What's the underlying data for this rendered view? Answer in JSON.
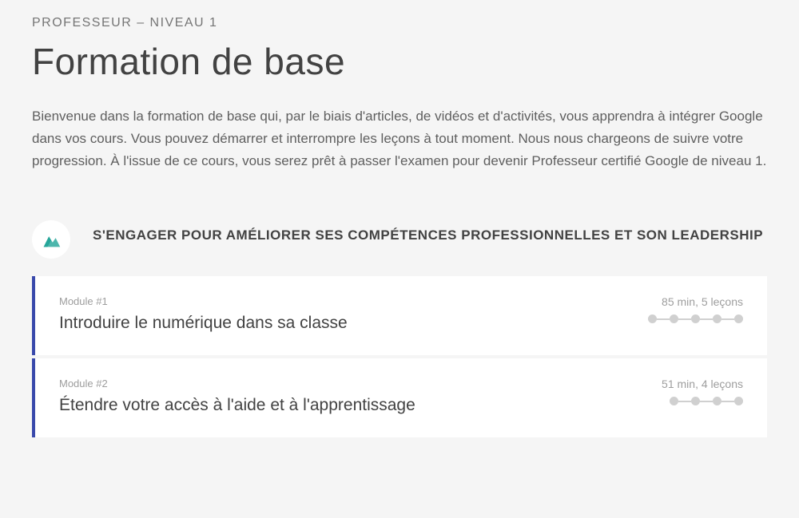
{
  "eyebrow": "PROFESSEUR – NIVEAU 1",
  "title": "Formation de base",
  "intro": "Bienvenue dans la formation de base qui, par le biais d'articles, de vidéos et d'activités, vous apprendra à intégrer Google dans vos cours. Vous pouvez démarrer et interrompre les leçons à tout moment. Nous nous chargeons de suivre votre progression. À l'issue de ce cours, vous serez prêt à passer l'examen pour devenir Professeur certifié Google de niveau 1.",
  "section": {
    "title": "S'ENGAGER POUR AMÉLIORER SES COMPÉTENCES PROFESSIONNELLES ET SON LEADERSHIP"
  },
  "modules": [
    {
      "number": "Module #1",
      "title": "Introduire le numérique dans sa classe",
      "meta": "85 min, 5 leçons",
      "lessons": 5
    },
    {
      "number": "Module #2",
      "title": "Étendre votre accès à l'aide et à l'apprentissage",
      "meta": "51 min, 4 leçons",
      "lessons": 4
    }
  ]
}
